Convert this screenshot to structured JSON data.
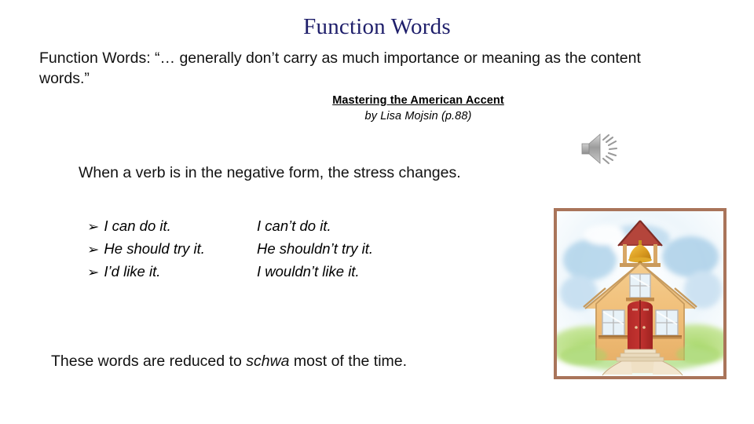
{
  "slide": {
    "title": "Function Words",
    "definition": "Function Words: “… generally don’t carry as much importance or meaning as the content words.”",
    "citation": {
      "source_title": "Mastering the American Accent",
      "author_line": "by Lisa Mojsin (p.88)"
    },
    "audio_icon_name": "speaker-audio-icon",
    "rule_line": "When a verb is in the negative form, the stress changes.",
    "examples": {
      "bullet_glyph": "➢",
      "rows": [
        {
          "affirmative": "I can do it.",
          "negative": "I can’t do it."
        },
        {
          "affirmative": "He should try it.",
          "negative": "He shouldn’t try it."
        },
        {
          "affirmative": "I’d like it.",
          "negative": "I wouldn’t like it."
        }
      ]
    },
    "closing": {
      "before": "These words are reduced to ",
      "emphasis": "schwa",
      "after": " most of the time."
    },
    "picture": {
      "alt_name": "schoolhouse-illustration",
      "frame_color": "#a9745a"
    },
    "colors": {
      "title": "#1f1f6b",
      "body": "#111111",
      "background": "#ffffff",
      "frame": "#a9745a"
    }
  }
}
